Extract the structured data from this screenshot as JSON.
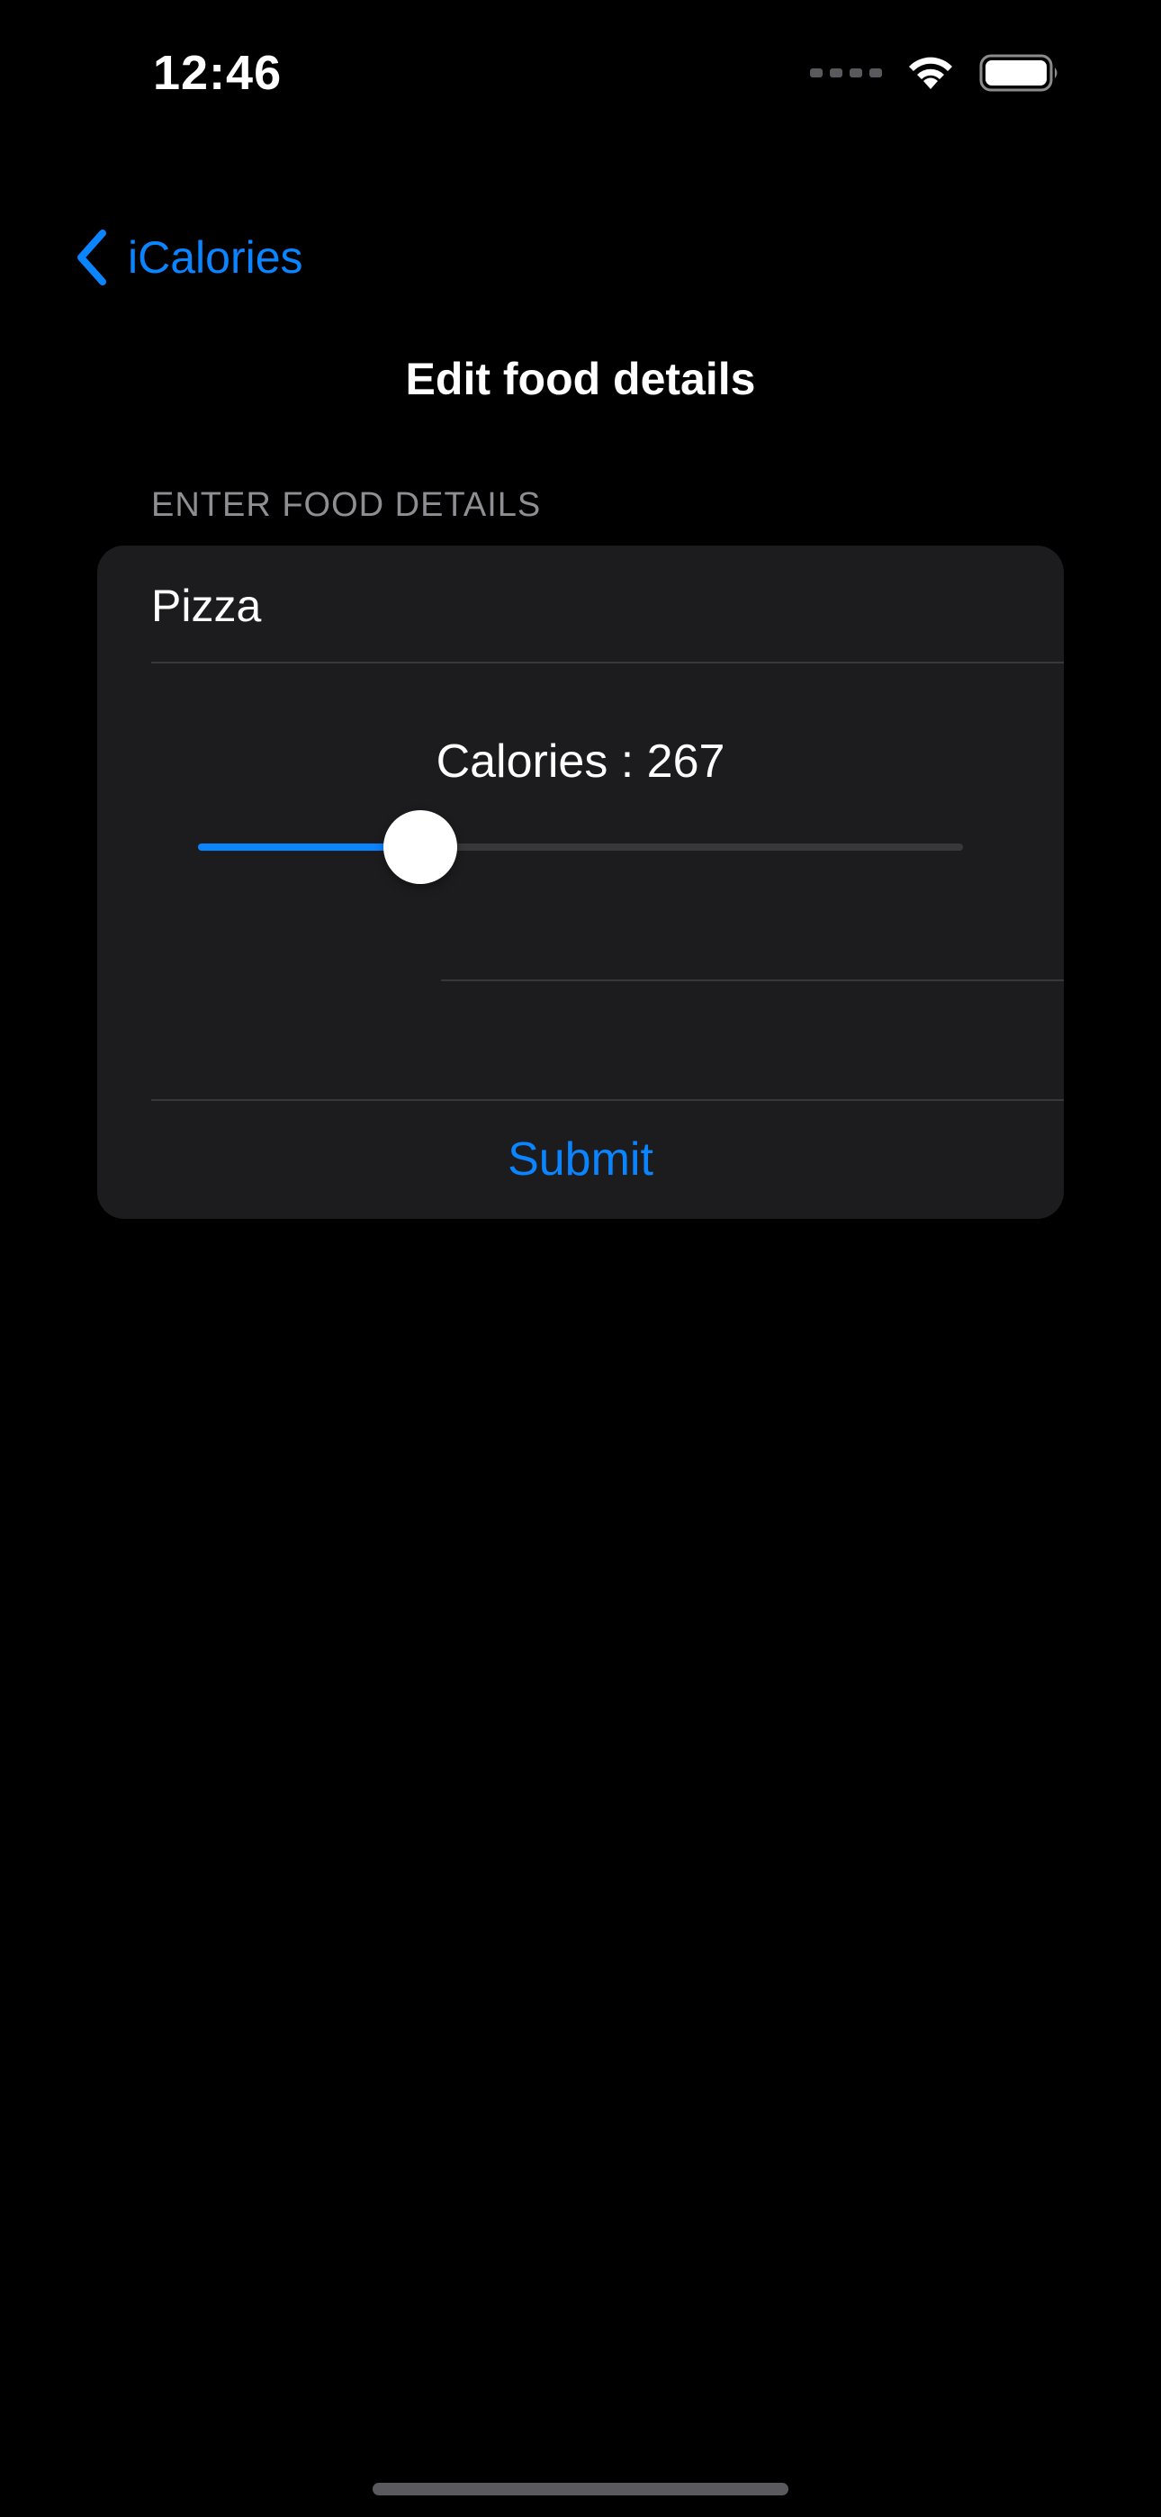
{
  "status_bar": {
    "time": "12:46",
    "icons": [
      "cellular-signal-icon",
      "wifi-icon",
      "battery-icon"
    ]
  },
  "nav": {
    "back_label": "iCalories",
    "back_icon": "chevron-left-icon"
  },
  "page": {
    "title": "Edit food details"
  },
  "form": {
    "section_header": "ENTER FOOD DETAILS",
    "food_name": "Pizza",
    "calories_label": "Calories : 267",
    "calories_slider_fraction": 0.29,
    "submit_label": "Submit"
  },
  "colors": {
    "background": "#000000",
    "card": "#1c1c1e",
    "accent": "#0a84ff",
    "secondary_text": "#8e8e93",
    "separator": "#38383a"
  }
}
